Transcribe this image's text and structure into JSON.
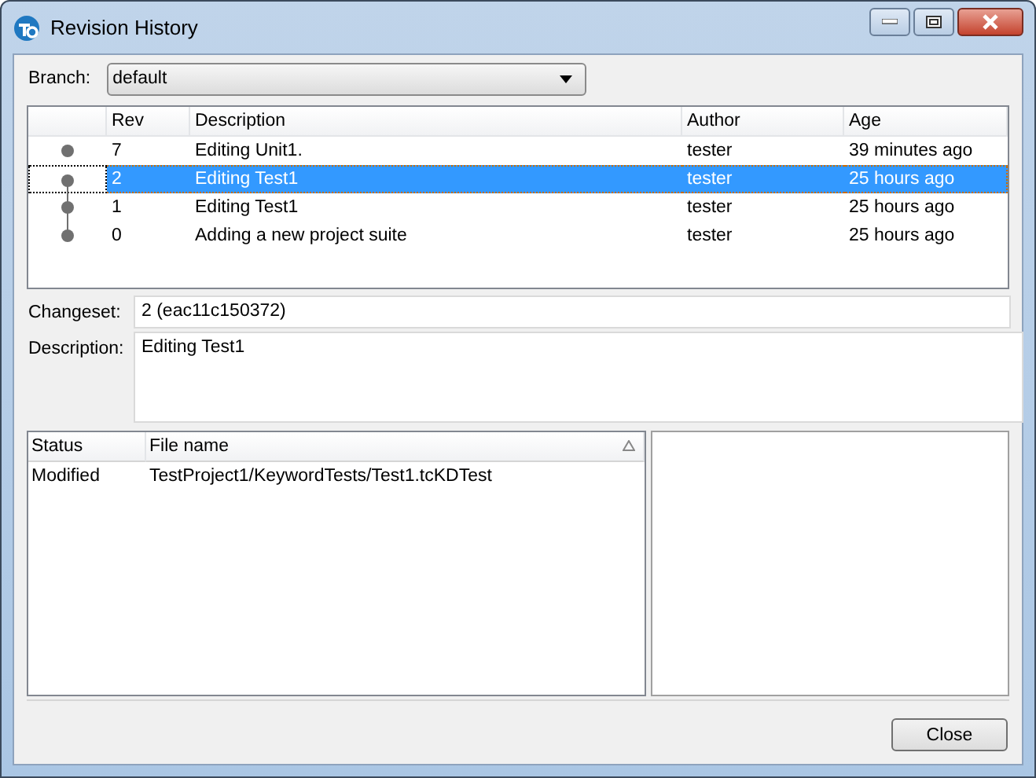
{
  "window": {
    "title": "Revision History"
  },
  "branch": {
    "label": "Branch:",
    "value": "default"
  },
  "revisions": {
    "columns": [
      "Rev",
      "Description",
      "Author",
      "Age"
    ],
    "rows": [
      {
        "rev": "7",
        "description": "Editing Unit1.",
        "author": "tester",
        "age": "39 minutes ago",
        "selected": false
      },
      {
        "rev": "2",
        "description": "Editing Test1",
        "author": "tester",
        "age": "25 hours ago",
        "selected": true
      },
      {
        "rev": "1",
        "description": "Editing Test1",
        "author": "tester",
        "age": "25 hours ago",
        "selected": false
      },
      {
        "rev": "0",
        "description": "Adding a new project suite",
        "author": "tester",
        "age": "25 hours ago",
        "selected": false
      }
    ]
  },
  "changeset": {
    "label": "Changeset:",
    "value": "2 (eac11c150372)"
  },
  "description": {
    "label": "Description:",
    "value": "Editing Test1"
  },
  "files": {
    "columns": [
      {
        "label": "Status",
        "sorted": false
      },
      {
        "label": "File name",
        "sorted": true
      }
    ],
    "rows": [
      {
        "status": "Modified",
        "file": "TestProject1/KeywordTests/Test1.tcKDTest"
      }
    ]
  },
  "buttons": [
    "Close"
  ]
}
